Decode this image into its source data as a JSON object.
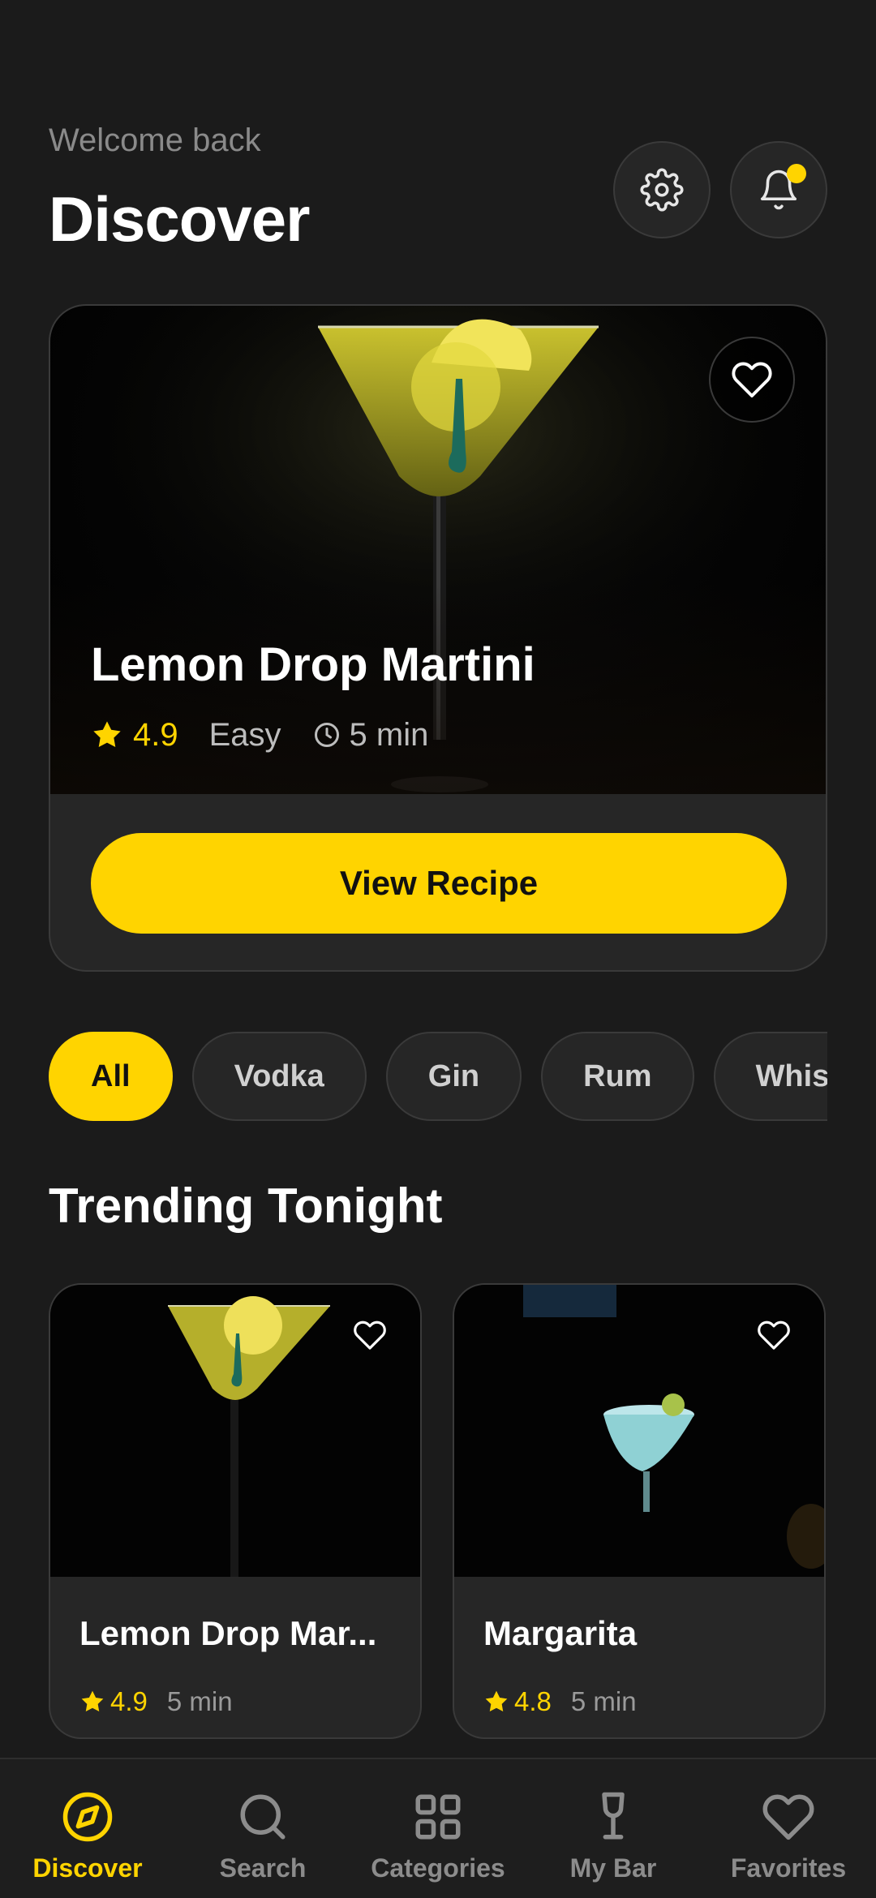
{
  "header": {
    "welcome": "Welcome back",
    "title": "Discover",
    "settings_icon": "gear-icon",
    "bell_icon": "bell-icon",
    "has_notification": true
  },
  "featured": {
    "name": "Lemon Drop Martini",
    "rating": "4.9",
    "difficulty": "Easy",
    "time": "5 min",
    "cta": "View Recipe"
  },
  "chips": [
    "All",
    "Vodka",
    "Gin",
    "Rum",
    "Whis"
  ],
  "active_chip": "All",
  "trending": {
    "title": "Trending Tonight",
    "items": [
      {
        "name": "Lemon Drop Mar...",
        "rating": "4.9",
        "time": "5 min"
      },
      {
        "name": "Margarita",
        "rating": "4.8",
        "time": "5 min"
      }
    ]
  },
  "nav": {
    "items": [
      {
        "label": "Discover",
        "icon": "compass-icon",
        "active": true
      },
      {
        "label": "Search",
        "icon": "search-icon",
        "active": false
      },
      {
        "label": "Categories",
        "icon": "grid-icon",
        "active": false
      },
      {
        "label": "My Bar",
        "icon": "wine-glass-icon",
        "active": false
      },
      {
        "label": "Favorites",
        "icon": "heart-icon",
        "active": false
      }
    ]
  },
  "colors": {
    "accent": "#ffd400",
    "background": "#1b1b1b",
    "card": "#262626"
  }
}
